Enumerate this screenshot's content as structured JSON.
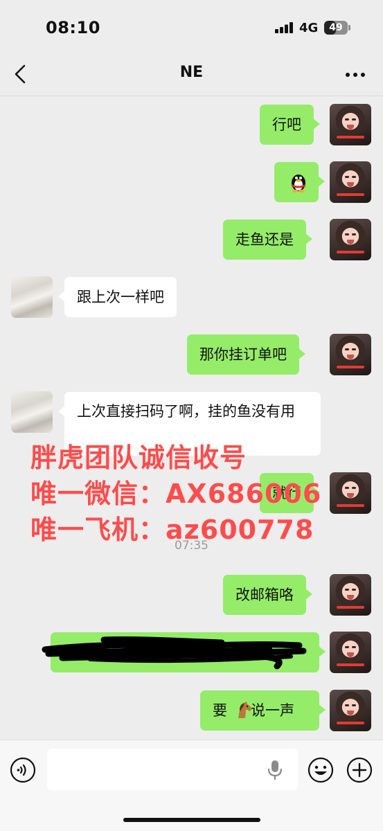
{
  "status_bar": {
    "time": "08:10",
    "network": "4G",
    "battery": "49",
    "battery_fraction": 0.49
  },
  "header": {
    "title": "NE",
    "back_icon": "chevron-left-icon",
    "more_icon": "ellipsis-icon"
  },
  "messages": [
    {
      "sender": "me",
      "text": "行吧"
    },
    {
      "sender": "me",
      "type": "emoji",
      "emoji": "penguin-sticker-icon",
      "text": ""
    },
    {
      "sender": "me",
      "text": "走鱼还是"
    },
    {
      "sender": "other",
      "text": "跟上次一样吧"
    },
    {
      "sender": "me",
      "text": "那你挂订单吧"
    },
    {
      "sender": "other",
      "text": "上次直接扫码了啊，挂的鱼没有用"
    },
    {
      "sender": "me",
      "text": "就行"
    },
    {
      "sender": "me",
      "text": "改邮箱咯"
    },
    {
      "sender": "me",
      "text": "",
      "redacted": true
    },
    {
      "sender": "me",
      "text_before": "要",
      "emoji": "horse-icon",
      "text_after": "说一声"
    }
  ],
  "timestamp": "07:35",
  "watermark": {
    "line1": "胖虎团队诚信收号",
    "line2": "唯一微信：AX686006",
    "line3": "唯一飞机：az600778"
  },
  "input_bar": {
    "placeholder": "",
    "voice_icon": "voice-toggle-icon",
    "mic_icon": "microphone-icon",
    "emoji_icon": "emoji-icon",
    "plus_icon": "plus-icon"
  },
  "colors": {
    "background": "#ededed",
    "my_bubble": "#95ec69",
    "other_bubble": "#ffffff",
    "watermark": "#ff4c4c"
  }
}
